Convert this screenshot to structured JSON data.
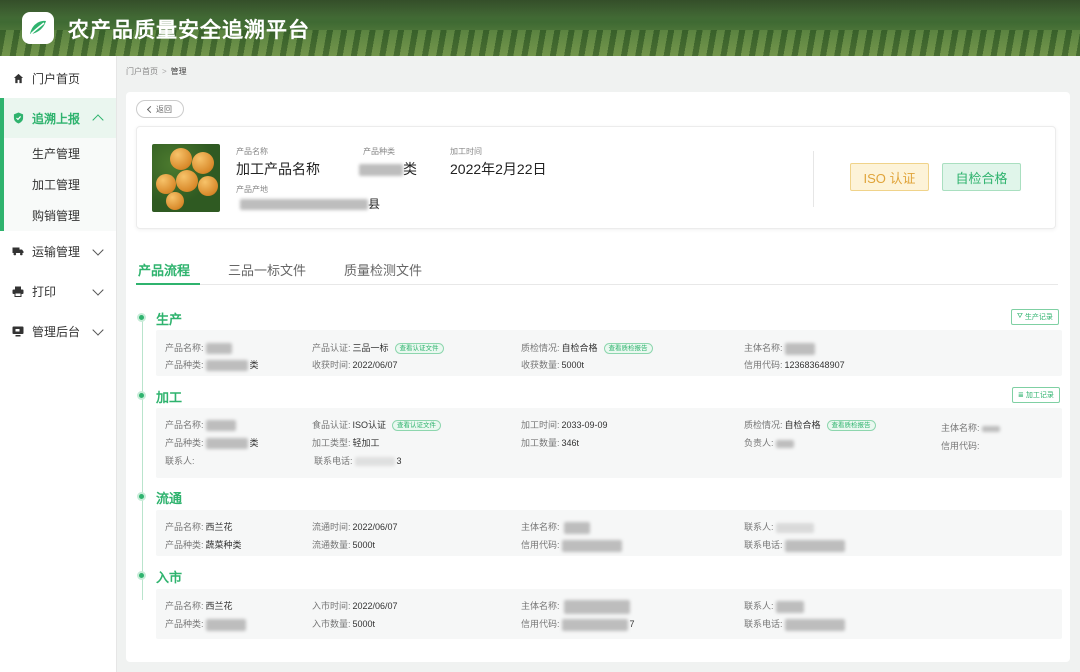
{
  "app": {
    "title": "农产品质量安全追溯平台"
  },
  "sidebar": {
    "items": [
      {
        "label": "门户首页",
        "icon": "home-icon"
      },
      {
        "label": "追溯上报",
        "icon": "shield-icon",
        "expanded": true,
        "children": [
          {
            "label": "生产管理"
          },
          {
            "label": "加工管理"
          },
          {
            "label": "购销管理"
          }
        ]
      },
      {
        "label": "运输管理",
        "icon": "truck-icon"
      },
      {
        "label": "打印",
        "icon": "printer-icon"
      },
      {
        "label": "管理后台",
        "icon": "monitor-icon"
      }
    ]
  },
  "breadcrumb": {
    "home": "门户首页",
    "current": "管理"
  },
  "back_label": "返回",
  "product": {
    "name_label": "产品名称",
    "name": "加工产品名称",
    "type_label": "产品种类",
    "type_suffix": "类",
    "time_label": "加工时间",
    "time": "2022年2月22日",
    "origin_label": "产品产地",
    "origin_suffix": "县",
    "badges": {
      "iso": "ISO 认证",
      "self_check": "自检合格"
    }
  },
  "tabs": [
    "产品流程",
    "三品一标文件",
    "质量检测文件"
  ],
  "active_tab": 0,
  "stages": {
    "production": {
      "title": "生产",
      "record_btn": "生产记录",
      "name_label": "产品名称:",
      "type_label": "产品种类:",
      "type_suffix": "类",
      "cert_label": "产品认证:",
      "cert": "三品一标",
      "cert_tag": "查看认证文件",
      "harvest_label": "收获时间:",
      "harvest": "2022/06/07",
      "qc_label": "质检情况:",
      "qc": "自检合格",
      "qc_tag": "查看质检报告",
      "qty_label": "收获数量:",
      "qty": "5000t",
      "subject_label": "主体名称:",
      "credit_label": "信用代码:",
      "credit": "123683648907"
    },
    "processing": {
      "title": "加工",
      "record_btn": "加工记录",
      "name_label": "产品名称:",
      "type_label": "产品种类:",
      "type_suffix": "类",
      "contact_label": "联系人:",
      "food_cert_label": "食品认证:",
      "food_cert": "ISO认证",
      "food_cert_tag": "查看认证文件",
      "proc_type_label": "加工类型:",
      "proc_type": "轻加工",
      "phone_label": "联系电话:",
      "phone_suffix": "3",
      "time_label": "加工时间:",
      "time": "2033-09-09",
      "qty_label": "加工数量:",
      "qty": "346t",
      "qc_label": "质检情况:",
      "qc": "自检合格",
      "qc_tag": "查看质检报告",
      "owner_label": "负责人:",
      "subject_label": "主体名称:",
      "credit_label": "信用代码:"
    },
    "circulation": {
      "title": "流通",
      "name_label": "产品名称:",
      "name": "西兰花",
      "type_label": "产品种类:",
      "type": "蔬菜种类",
      "time_label": "流通时间:",
      "time": "2022/06/07",
      "qty_label": "流通数量:",
      "qty": "5000t",
      "subject_label": "主体名称:",
      "credit_label": "信用代码:",
      "contact_label": "联系人:",
      "phone_label": "联系电话:"
    },
    "market": {
      "title": "入市",
      "name_label": "产品名称:",
      "name": "西兰花",
      "type_label": "产品种类:",
      "time_label": "入市时间:",
      "time": "2022/06/07",
      "qty_label": "入市数量:",
      "qty": "5000t",
      "subject_label": "主体名称:",
      "credit_label": "信用代码:",
      "credit_suffix": "7",
      "contact_label": "联系人:",
      "phone_label": "联系电话:"
    }
  },
  "colors": {
    "accent": "#2fb36e",
    "iso_bg": "#fdf3d8",
    "iso_text": "#e0a43a"
  }
}
